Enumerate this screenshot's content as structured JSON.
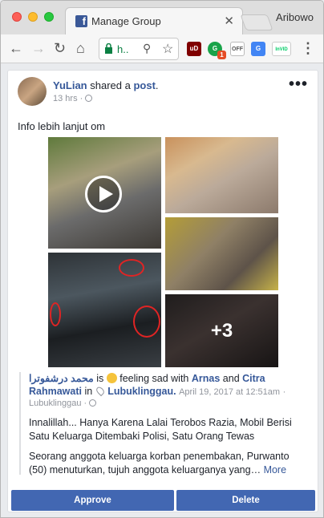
{
  "browser": {
    "tab_title": "Manage Group",
    "profile_name": "Aribowo",
    "url_text": "h.."
  },
  "extensions": [
    {
      "name": "ublock-icon",
      "color": "#800000",
      "label": "uD"
    },
    {
      "name": "grammarly-icon",
      "color": "#1aa34a",
      "label": "G",
      "badge": "1"
    },
    {
      "name": "off-icon",
      "color": "#777777",
      "label": "OFF"
    },
    {
      "name": "translate-icon",
      "color": "#4285f4",
      "label": "G"
    },
    {
      "name": "invid-icon",
      "color": "#ffffff",
      "label": "InVID"
    }
  ],
  "post": {
    "author": "YuLian",
    "action_prefix": "shared a",
    "action_link": "post",
    "time": "13 hrs",
    "text": "Info lebih lanjut om",
    "more_photos": "+3"
  },
  "shared": {
    "author": "محمد درشفوترا",
    "is": "is",
    "feeling": "feeling sad with",
    "with1": "Arnas",
    "and": "and",
    "with2": "Citra Rahmawati",
    "in": "in",
    "place": "Lubuklinggau.",
    "date": "April 19, 2017 at 12:51am",
    "place2": "Lubuklinggau",
    "headline": "Innalillah... Hanya Karena Lalai Terobos Razia, Mobil Berisi Satu Keluarga Ditembaki Polisi, Satu Orang Tewas",
    "body": "Seorang anggota keluarga korban penembakan, Purwanto (50) menuturkan, tujuh anggota keluarganya yang…",
    "more": "More"
  },
  "actions": {
    "approve": "Approve",
    "delete": "Delete"
  }
}
